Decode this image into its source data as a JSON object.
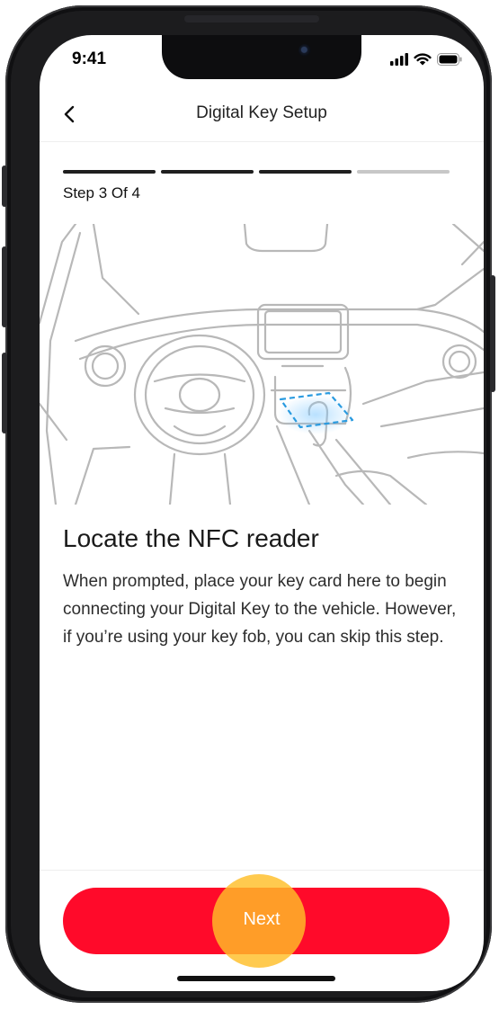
{
  "status_bar": {
    "time": "9:41"
  },
  "navbar": {
    "title": "Digital Key Setup",
    "back_icon": "chevron-left-icon"
  },
  "progress": {
    "current_step": 3,
    "total_steps": 4,
    "label": "Step 3 Of 4"
  },
  "content": {
    "heading": "Locate the NFC reader",
    "body": "When prompted, place your key card here to begin connecting your Digital Key to the vehicle. However, if you’re using your key fob, you can skip this step."
  },
  "footer": {
    "next_label": "Next"
  },
  "colors": {
    "primary": "#ff0a2a",
    "nfc_highlight": "#2a9be0",
    "tap_indicator": "#ffbe28"
  }
}
